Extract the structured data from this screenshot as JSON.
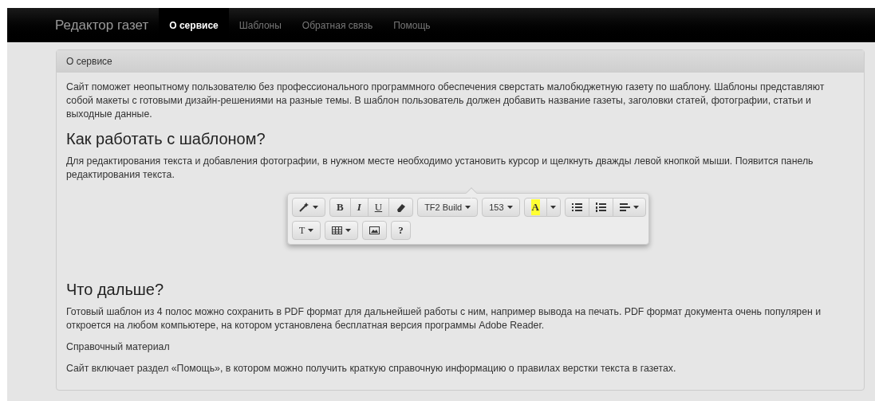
{
  "navbar": {
    "brand": "Редактор газет",
    "items": [
      {
        "label": "О сервисе",
        "selected": true
      },
      {
        "label": "Шаблоны",
        "selected": false
      },
      {
        "label": "Обратная связь",
        "selected": false
      },
      {
        "label": "Помощь",
        "selected": false
      }
    ]
  },
  "panel": {
    "title": "О сервисе",
    "blocks": [
      {
        "kind": "paragraph",
        "text": "Сайт поможет неопытному пользователю без профессионального программного обеспечения сверстать малобюджетную газету по шаблону. Шаблоны представляют собой макеты с готовыми дизайн-решениями на разные темы. В шаблон пользователь должен добавить название газеты, заголовки статей, фотографии, статьи и выходные данные."
      },
      {
        "kind": "heading",
        "text": "Как работать с шаблоном?"
      },
      {
        "kind": "paragraph",
        "text": "Для редактирования текста и добавления фотографии, в нужном месте необходимо установить курсор и щелкнуть дважды левой кнопкой мыши. Появится панель редактирования текста."
      },
      {
        "kind": "toolbar",
        "rows": [
          [
            [
              {
                "kind": "wand",
                "caret": true
              }
            ],
            [
              {
                "kind": "bold",
                "label": "B",
                "caret": false
              },
              {
                "kind": "italic",
                "label": "I",
                "caret": false
              },
              {
                "kind": "underline",
                "label": "U",
                "caret": false
              },
              {
                "kind": "eraser",
                "caret": false
              }
            ],
            [
              {
                "kind": "menu",
                "label": "TF2 Build",
                "caret": true
              }
            ],
            [
              {
                "kind": "menu",
                "label": "153",
                "caret": true
              }
            ],
            [
              {
                "kind": "highlight",
                "label": "A",
                "caret": false
              },
              {
                "kind": "dropdown",
                "caret": true
              }
            ],
            [
              {
                "kind": "list",
                "caret": false
              },
              {
                "kind": "numbered",
                "caret": false
              },
              {
                "kind": "align",
                "caret": true
              }
            ]
          ],
          [
            [
              {
                "kind": "font",
                "label": "T",
                "caret": true
              }
            ],
            [
              {
                "kind": "table",
                "caret": true
              }
            ],
            [
              {
                "kind": "image",
                "caret": false
              }
            ],
            [
              {
                "kind": "bold",
                "label": "?",
                "caret": false
              }
            ]
          ]
        ]
      },
      {
        "kind": "heading",
        "text": "Что дальше?"
      },
      {
        "kind": "paragraph",
        "text": "Готовый шаблон из 4 полос можно сохранить в PDF формат для дальнейшей работы с ним, например вывода на печать. PDF формат документа очень популярен и откроется на любом компьютере, на котором установлена бесплатная версия программы Adobe Reader."
      },
      {
        "kind": "paragraph",
        "text": "Справочный материал"
      },
      {
        "kind": "paragraph",
        "text": "Сайт включает раздел «Помощь», в котором можно получить краткую справочную информацию о правилах верстки текста в газетах."
      }
    ]
  }
}
